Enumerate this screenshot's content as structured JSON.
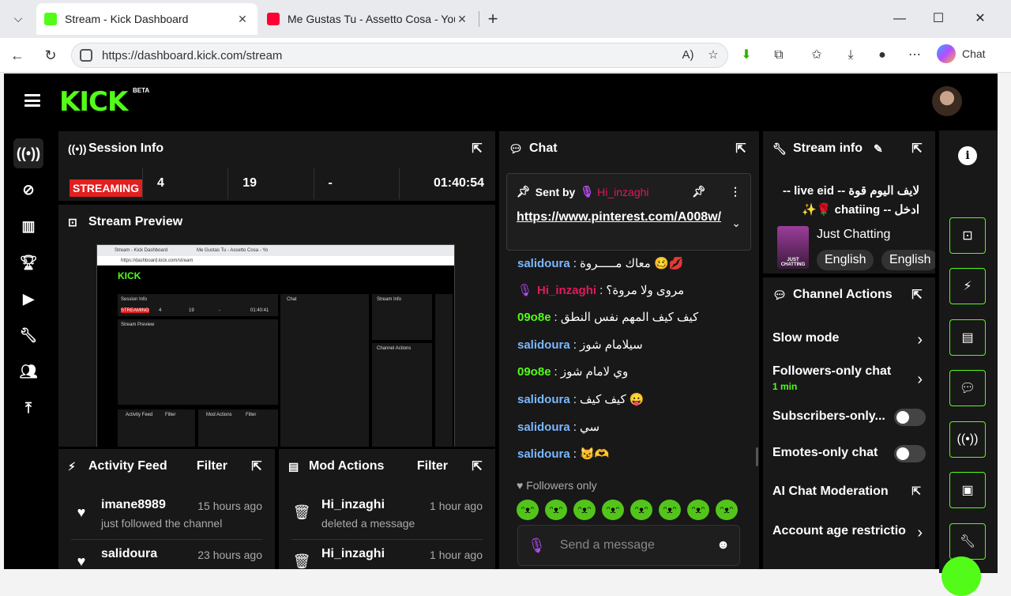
{
  "browser": {
    "tabs": [
      {
        "title": "Stream - Kick Dashboard",
        "active": true
      },
      {
        "title": "Me Gustas Tu - Assetto Cosa - YouTube",
        "active": false
      }
    ],
    "url": "https://dashboard.kick.com/stream",
    "copilot_label": "Chat"
  },
  "app": {
    "logo": "KICK",
    "beta": "BETA",
    "session": {
      "title": "Session Info",
      "status": "STREAMING",
      "stats": [
        "4",
        "19",
        "-",
        "01:40:54"
      ]
    },
    "preview": {
      "title": "Stream Preview",
      "mini": {
        "tab1": "Stream - Kick Dashboard",
        "tab2": "Me Gustas Tu - Assetto Cosa - Yo",
        "url": "https://dashboard.kick.com/stream",
        "logo": "KICK",
        "session": "Session Info",
        "streaming": "STREAMING",
        "stat1": "4",
        "stat2": "19",
        "stat3": "-",
        "time": "01:40:41",
        "preview": "Stream Preview",
        "chat": "Chat",
        "stream_info": "Stream Info",
        "activity": "Activity Feed",
        "mod": "Mod Actions",
        "filter": "Filter",
        "channel_actions": "Channel Actions"
      }
    },
    "activity": {
      "title": "Activity Feed",
      "filter": "Filter",
      "items": [
        {
          "name": "imane8989",
          "time": "15 hours ago",
          "sub": "just followed the channel"
        },
        {
          "name": "salidoura",
          "time": "23 hours ago",
          "sub": ""
        }
      ]
    },
    "mod": {
      "title": "Mod Actions",
      "filter": "Filter",
      "items": [
        {
          "name": "Hi_inzaghi",
          "time": "1 hour ago",
          "sub": "deleted a message"
        },
        {
          "name": "Hi_inzaghi",
          "time": "1 hour ago",
          "sub": ""
        }
      ]
    },
    "chat": {
      "title": "Chat",
      "pinned": {
        "sent_by": "Sent by",
        "user": "Hi_inzaghi",
        "link": "https://www.pinterest.com/A008w/"
      },
      "messages": [
        {
          "user": "salidoura",
          "color": "#7ab8ff",
          "text": "معاك مـــــروة 🥴💋"
        },
        {
          "user": "Hi_inzaghi",
          "color": "#e0195a",
          "text": "مروى ولا مروة؟",
          "mic": true
        },
        {
          "user": "09o8e",
          "color": "#53fc18",
          "text": "كيف كيف المهم نفس النطق"
        },
        {
          "user": "salidoura",
          "color": "#7ab8ff",
          "text": "سيلامام شوز"
        },
        {
          "user": "09o8e",
          "color": "#53fc18",
          "text": "وي لامام شوز"
        },
        {
          "user": "salidoura",
          "color": "#7ab8ff",
          "text": "كيف كيف 😛"
        },
        {
          "user": "salidoura",
          "color": "#7ab8ff",
          "text": "سي"
        },
        {
          "user": "salidoura",
          "color": "#7ab8ff",
          "text": "😼🫶"
        }
      ],
      "followers_only": "Followers only",
      "placeholder": "Send a message"
    },
    "stream_info": {
      "title": "Stream info",
      "stream_title": "لايف اليوم قوة -- live eid -- ادخل -- chatiing 🌹✨",
      "category": "Just Chatting",
      "thumb_label": "JUST CHATTING",
      "tags": [
        "English",
        "English"
      ]
    },
    "channel_actions": {
      "title": "Channel Actions",
      "items": [
        {
          "label": "Slow mode",
          "sub": ""
        },
        {
          "label": "Followers-only chat",
          "sub": "1 min"
        },
        {
          "label": "Subscribers-only...",
          "sub": ""
        },
        {
          "label": "Emotes-only chat",
          "sub": ""
        },
        {
          "label": "AI Chat Moderation",
          "sub": ""
        },
        {
          "label": "Account age restrictio",
          "sub": ""
        }
      ]
    }
  },
  "colors": {
    "accent": "#53fc18",
    "streaming": "#e11f1f",
    "panel": "#181818"
  }
}
